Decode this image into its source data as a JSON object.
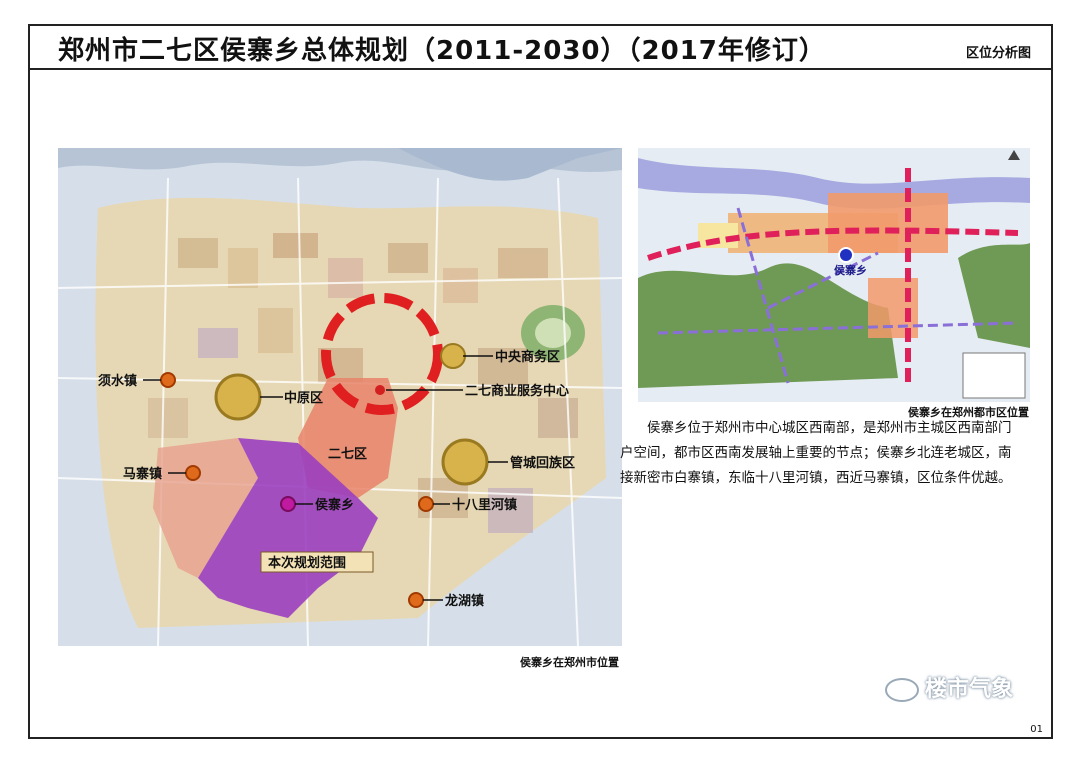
{
  "header": {
    "title": "郑州市二七区侯寨乡总体规划（2011-2030）（2017年修订）",
    "subtitle": "区位分析图"
  },
  "main_map": {
    "caption": "侯寨乡在郑州市位置",
    "labels": {
      "cbd": "中央商务区",
      "erqi_center": "二七商业服务中心",
      "zhongyuan": "中原区",
      "xushui": "须水镇",
      "erqi": "二七区",
      "guancheng": "管城回族区",
      "mazhai": "马寨镇",
      "houzhai": "侯寨乡",
      "shibali": "十八里河镇",
      "planning_scope": "本次规划范围",
      "longhu": "龙湖镇"
    }
  },
  "inset_map": {
    "caption": "侯寨乡在郑州都市区位置",
    "labels": {
      "houzhai": "侯寨乡"
    }
  },
  "description": "侯寨乡位于郑州市中心城区西南部，是郑州市主城区西南部门户空间，都市区西南发展轴上重要的节点；侯寨乡北连老城区，南接新密市白寨镇，东临十八里河镇，西近马寨镇，区位条件优越。",
  "watermark": "楼市气象",
  "page_number": "01",
  "colors": {
    "water": "#b9c7d9",
    "urban": "#ead9b0",
    "planning_area": "#9b3fc0",
    "erqi_district": "#e8826a",
    "cbd_ring": "#e02020",
    "axis": "#e0205a",
    "inset_axis": "#8a6fd8",
    "green": "#6f9a55"
  }
}
